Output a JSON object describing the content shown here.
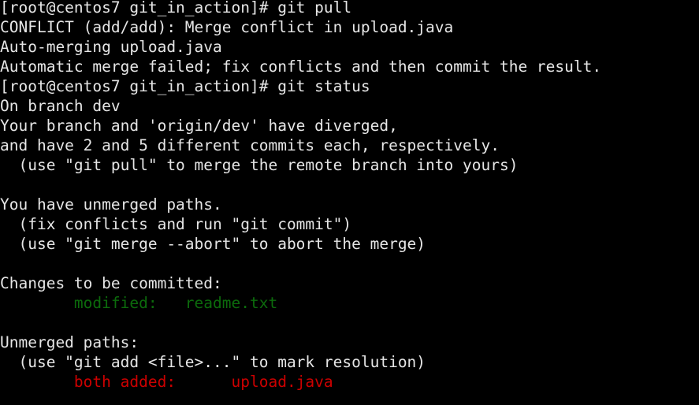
{
  "terminal": {
    "window_title": "root@centos7:~/git_in_action",
    "shell_prompt": "[root@centos7 git_in_action]#",
    "colors": {
      "background": "#000000",
      "foreground": "#e6e6e6",
      "green": "#0c6b0c",
      "red": "#cc0000"
    },
    "columns": 73,
    "rows": 21,
    "lines": [
      {
        "index": 0,
        "type": "command",
        "segments": [
          {
            "text": "[root@centos7 git_in_action]# git pull",
            "color": "default"
          }
        ]
      },
      {
        "index": 1,
        "type": "output",
        "segments": [
          {
            "text": "CONFLICT (add/add): Merge conflict in upload.java",
            "color": "default"
          }
        ]
      },
      {
        "index": 2,
        "type": "output",
        "segments": [
          {
            "text": "Auto-merging upload.java",
            "color": "default"
          }
        ]
      },
      {
        "index": 3,
        "type": "output",
        "segments": [
          {
            "text": "Automatic merge failed; fix conflicts and then commit the result.",
            "color": "default"
          }
        ]
      },
      {
        "index": 4,
        "type": "command",
        "segments": [
          {
            "text": "[root@centos7 git_in_action]# git status",
            "color": "default"
          }
        ]
      },
      {
        "index": 5,
        "type": "output",
        "segments": [
          {
            "text": "On branch dev",
            "color": "default"
          }
        ]
      },
      {
        "index": 6,
        "type": "output",
        "segments": [
          {
            "text": "Your branch and 'origin/dev' have diverged,",
            "color": "default"
          }
        ]
      },
      {
        "index": 7,
        "type": "output",
        "segments": [
          {
            "text": "and have 2 and 5 different commits each, respectively.",
            "color": "default"
          }
        ]
      },
      {
        "index": 8,
        "type": "hint",
        "segments": [
          {
            "text": "  (use \"git pull\" to merge the remote branch into yours)",
            "color": "default"
          }
        ]
      },
      {
        "index": 9,
        "type": "blank",
        "segments": [
          {
            "text": "",
            "color": "default"
          }
        ]
      },
      {
        "index": 10,
        "type": "output",
        "segments": [
          {
            "text": "You have unmerged paths.",
            "color": "default"
          }
        ]
      },
      {
        "index": 11,
        "type": "hint",
        "segments": [
          {
            "text": "  (fix conflicts and run \"git commit\")",
            "color": "default"
          }
        ]
      },
      {
        "index": 12,
        "type": "hint",
        "segments": [
          {
            "text": "  (use \"git merge --abort\" to abort the merge)",
            "color": "default"
          }
        ]
      },
      {
        "index": 13,
        "type": "blank",
        "segments": [
          {
            "text": "",
            "color": "default"
          }
        ]
      },
      {
        "index": 14,
        "type": "section-header",
        "segments": [
          {
            "text": "Changes to be committed:",
            "color": "default"
          }
        ]
      },
      {
        "index": 15,
        "type": "file-status",
        "segments": [
          {
            "text": "        modified:   readme.txt",
            "color": "green"
          }
        ]
      },
      {
        "index": 16,
        "type": "blank",
        "segments": [
          {
            "text": "",
            "color": "default"
          }
        ]
      },
      {
        "index": 17,
        "type": "section-header",
        "segments": [
          {
            "text": "Unmerged paths:",
            "color": "default"
          }
        ]
      },
      {
        "index": 18,
        "type": "hint",
        "segments": [
          {
            "text": "  (use \"git add <file>...\" to mark resolution)",
            "color": "default"
          }
        ]
      },
      {
        "index": 19,
        "type": "file-status",
        "segments": [
          {
            "text": "        both added:      upload.java",
            "color": "red"
          }
        ]
      }
    ]
  }
}
